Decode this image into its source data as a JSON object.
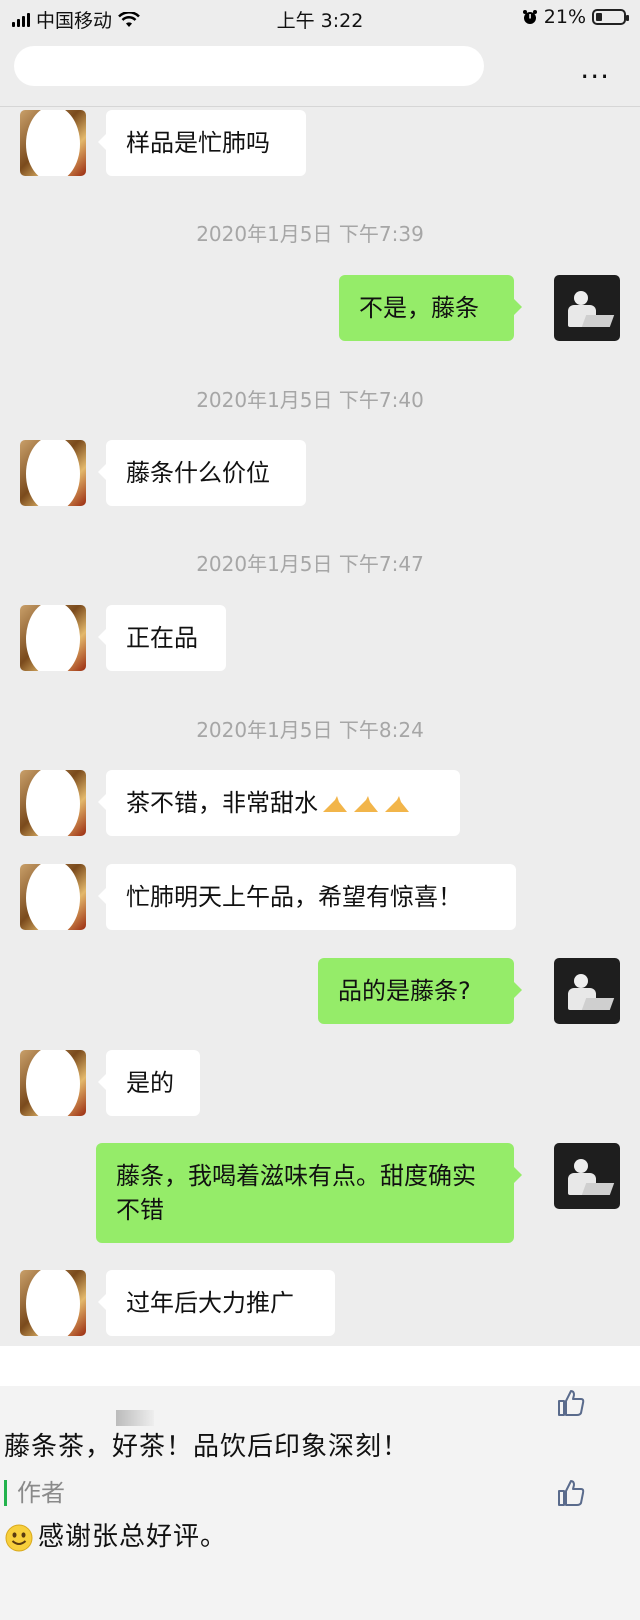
{
  "status_bar": {
    "carrier": "中国移动",
    "time": "上午 3:22",
    "battery": "21%"
  },
  "nav": {
    "more_label": "..."
  },
  "messages": [
    {
      "text": "样品是忙肺吗"
    },
    {
      "ts": "2020年1月5日 下午7:39"
    },
    {
      "text": "不是，藤条"
    },
    {
      "ts": "2020年1月5日 下午7:40"
    },
    {
      "text": "藤条什么价位"
    },
    {
      "ts": "2020年1月5日 下午7:47"
    },
    {
      "text": "正在品"
    },
    {
      "ts": "2020年1月5日 下午8:24"
    },
    {
      "text": "茶不错，非常甜水"
    },
    {
      "text": "忙肺明天上午品，希望有惊喜！"
    },
    {
      "text": "品的是藤条?"
    },
    {
      "text": "是的"
    },
    {
      "text": "藤条，我喝着滋味有点。甜度确实不错"
    },
    {
      "text": "过年后大力推广"
    }
  ],
  "comments": {
    "comment_text": "藤条茶，好茶！品饮后印象深刻！",
    "author_label": "作者",
    "reply_text": "感谢张总好评。"
  },
  "colors": {
    "sent_bubble": "#95ec69",
    "received_bubble": "#ffffff",
    "author_bar": "#22b24c"
  }
}
